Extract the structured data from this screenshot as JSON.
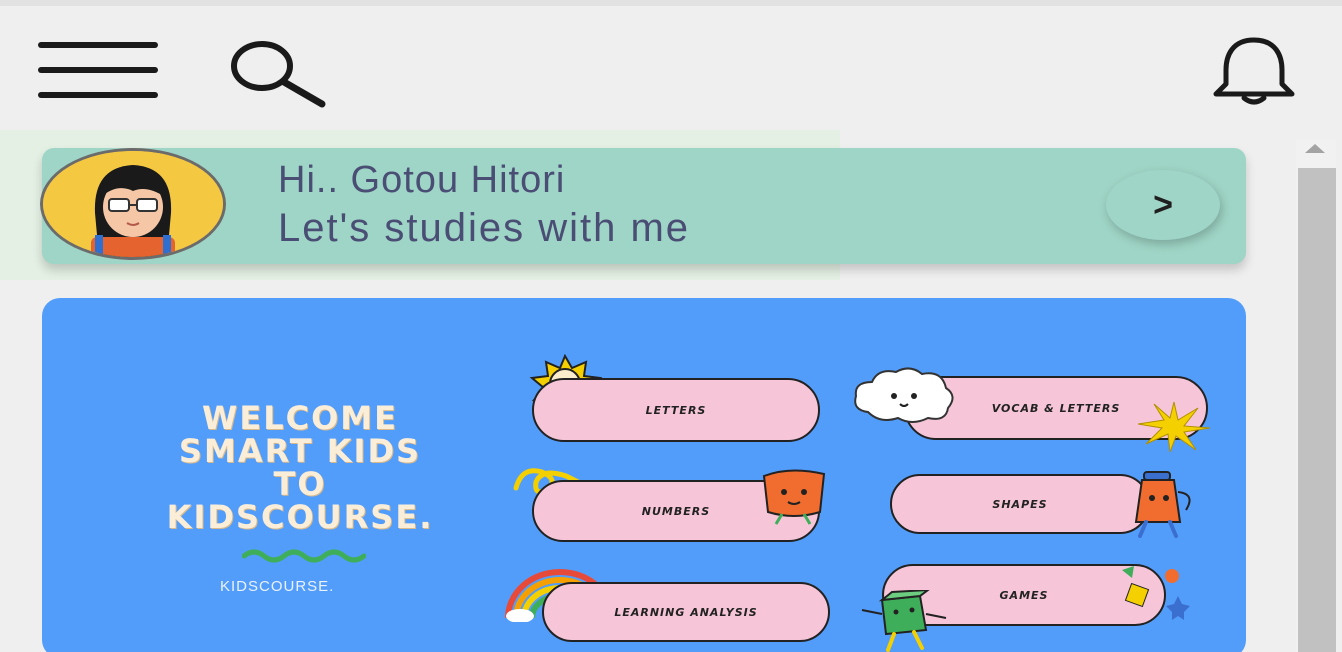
{
  "header": {
    "menu_icon": "hamburger-menu-icon",
    "search_icon": "search-icon",
    "bell_icon": "bell-icon"
  },
  "greeting": {
    "line1": "Hi.. Gotou Hitori",
    "line2": "Let's studies with me",
    "next_label": ">"
  },
  "banner": {
    "welcome_lines": [
      "WELCOME",
      "SMART KIDS",
      "TO",
      "KIDSCOURSE."
    ],
    "brand": "KIDSCOURSE.",
    "menu": [
      "LETTERS",
      "VOCAB & LETTERS",
      "NUMBERS",
      "SHAPES",
      "LEARNING ANALYSIS",
      "GAMES"
    ]
  },
  "colors": {
    "background": "#efefef",
    "greeting_card": "#9fd5c6",
    "greeting_text": "#4a4e75",
    "banner": "#539dfa",
    "pill": "#f6c6d8",
    "welcome_text": "#fbeed8"
  }
}
